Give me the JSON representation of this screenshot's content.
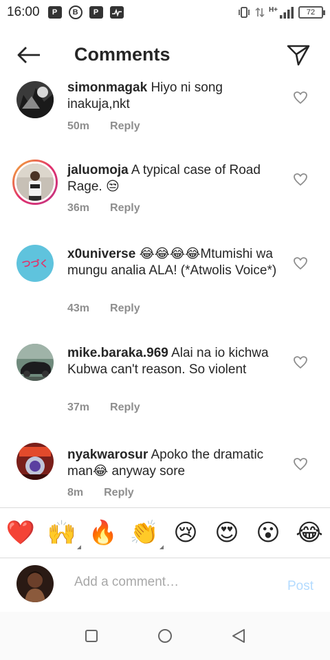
{
  "status_bar": {
    "time": "16:00",
    "left_icons": [
      "P",
      "B",
      "P",
      "activity"
    ],
    "battery": "72",
    "signal": "H+"
  },
  "header": {
    "title": "Comments",
    "back_icon": "arrow-left-icon",
    "send_icon": "send-icon"
  },
  "comments": [
    {
      "username": "simonmagak",
      "text": "Hiyo ni song inakuja,nkt",
      "time": "50m",
      "reply_label": "Reply"
    },
    {
      "username": "jaluomoja",
      "text": "A typical case of Road Rage. 😒",
      "time": "36m",
      "reply_label": "Reply"
    },
    {
      "username": "x0universe",
      "text": "😂😂😂😂Mtumishi wa mungu analia  ALA! (*Atwolis Voice*)",
      "time": "43m",
      "reply_label": "Reply"
    },
    {
      "username": "mike.baraka.969",
      "text": "Alai na io kichwa Kubwa can't reason. So violent",
      "time": "37m",
      "reply_label": "Reply"
    },
    {
      "username": "nyakwarosur",
      "text": "Apoko the dramatic man😂 anyway sore",
      "time": "8m",
      "reply_label": "Reply"
    }
  ],
  "emoji_bar": [
    "❤️",
    "🙌",
    "🔥",
    "👏",
    "😢",
    "😍",
    "😮",
    "😂"
  ],
  "composer": {
    "placeholder": "Add a comment…",
    "post_label": "Post"
  },
  "colors": {
    "accent_disabled": "#b3dbff",
    "text": "#262626",
    "meta": "#8e8e8e"
  }
}
